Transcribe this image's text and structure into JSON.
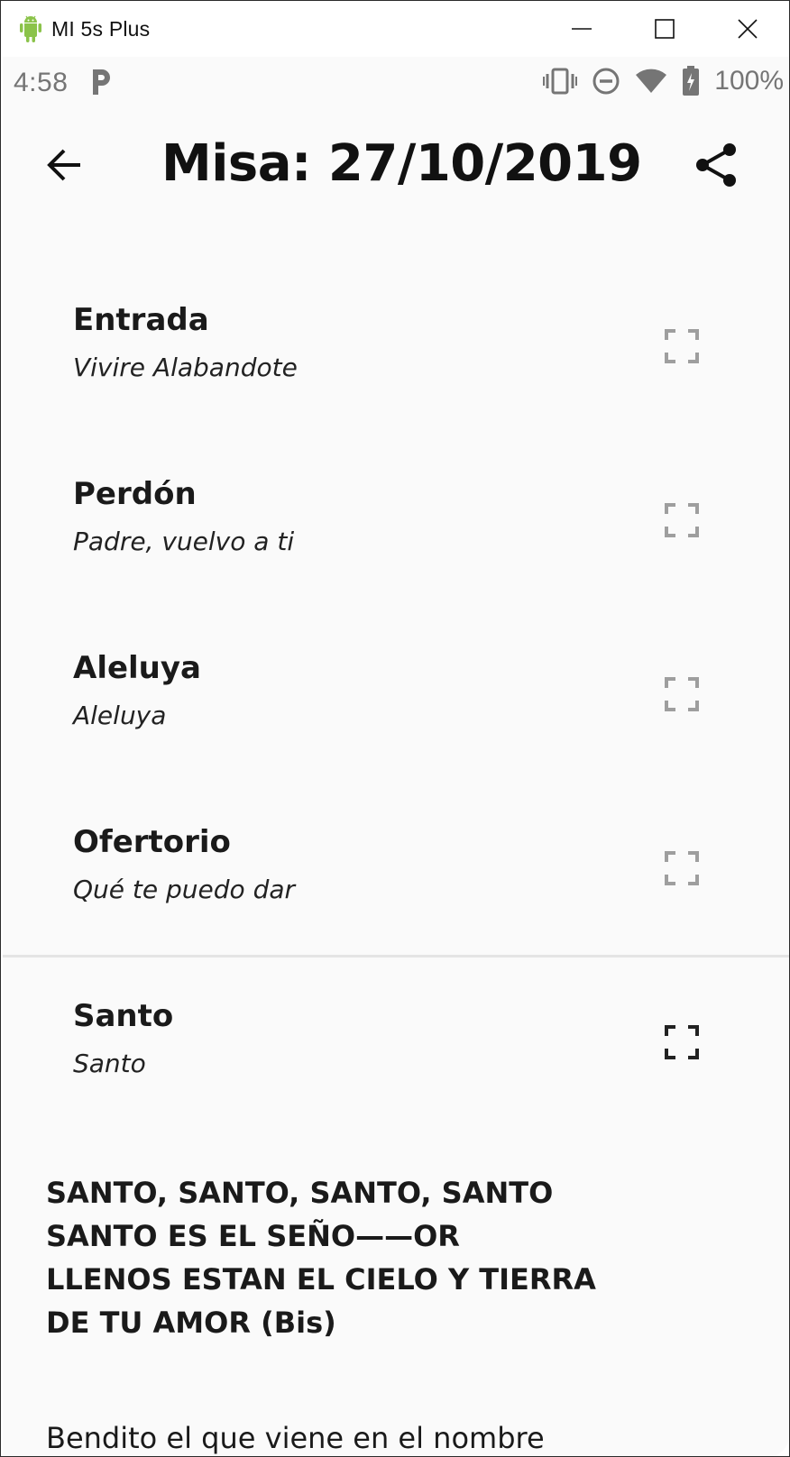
{
  "window": {
    "title": "MI 5s Plus",
    "controls": [
      "minimize-icon",
      "maximize-icon",
      "close-icon"
    ]
  },
  "statusbar": {
    "time": "4:58",
    "notification_icon": "p-icon",
    "icons": [
      "vibrate-icon",
      "do-not-disturb-icon",
      "wifi-icon",
      "battery-charging-icon"
    ],
    "battery": "100%"
  },
  "toolbar": {
    "title": "Misa: 27/10/2019",
    "back_icon": "arrow-back-icon",
    "share_icon": "share-icon"
  },
  "items": [
    {
      "name": "Entrada",
      "song": "Vivire Alabandote",
      "icon_color": "#9e9e9e"
    },
    {
      "name": "Perdón",
      "song": "Padre, vuelvo a ti",
      "icon_color": "#9e9e9e"
    },
    {
      "name": "Aleluya",
      "song": "Aleluya",
      "icon_color": "#9e9e9e"
    },
    {
      "name": "Ofertorio",
      "song": "Qué te puedo dar",
      "icon_color": "#9e9e9e"
    },
    {
      "name": "Santo",
      "song": "Santo",
      "icon_color": "#222222"
    }
  ],
  "lyrics": {
    "chorus": [
      "SANTO, SANTO, SANTO, SANTO",
      "SANTO ES EL SEÑO——OR",
      "LLENOS ESTAN EL CIELO Y TIERRA",
      "DE TU AMOR (Bis)"
    ],
    "verse": [
      "Bendito el que viene en el nombre"
    ]
  }
}
